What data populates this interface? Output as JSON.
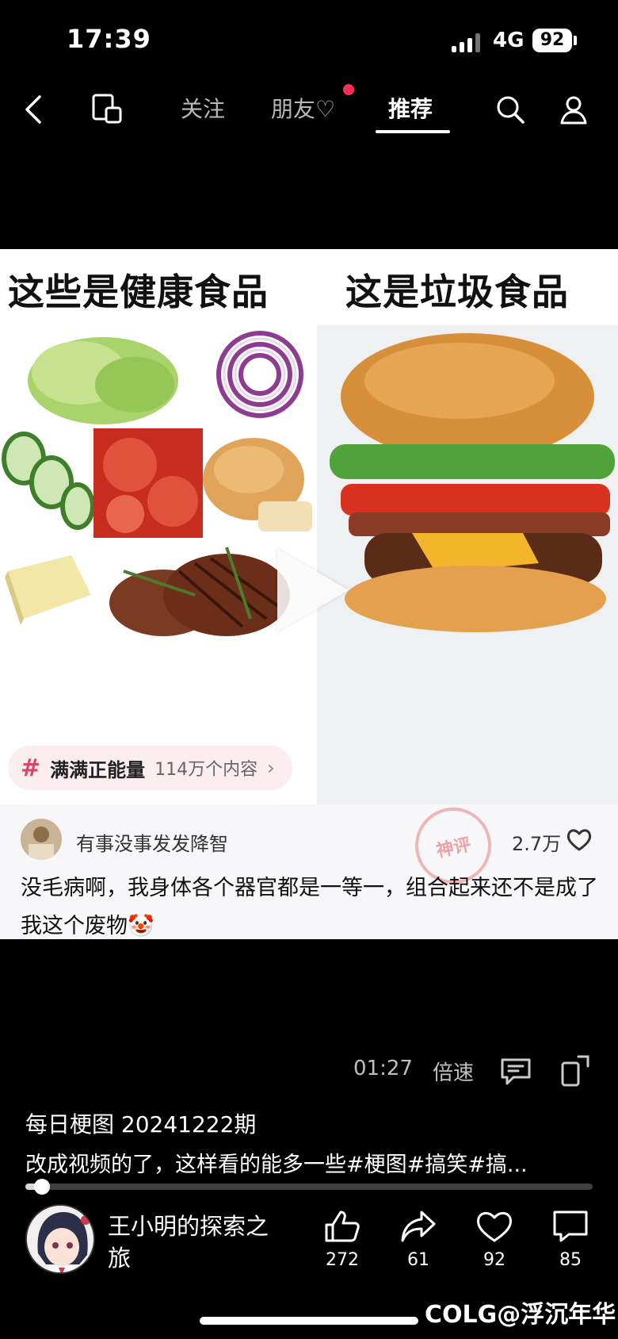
{
  "status_bar": {
    "time": "17:39",
    "network": "4G",
    "battery": "92"
  },
  "nav": {
    "tabs": [
      {
        "label": "关注",
        "active": false
      },
      {
        "label": "朋友♡",
        "active": false,
        "has_dot": true
      },
      {
        "label": "推荐",
        "active": true
      }
    ]
  },
  "meme": {
    "left_heading": "这些是健康食品",
    "right_heading": "这是垃圾食品",
    "topic": {
      "name": "满满正能量",
      "count": "114万个内容"
    },
    "comment": {
      "username": "有事没事发发降智",
      "likes": "2.7万",
      "text": "没毛病啊，我身体各个器官都是一等一，组合起来还不是成了我这个废物🤡",
      "stamp": "神评"
    }
  },
  "player": {
    "time": "01:27",
    "speed_label": "倍速",
    "progress_fraction": 0.03
  },
  "video": {
    "title": "每日梗图 20241222期",
    "description": "改成视频的了，这样看的能多一些#梗图#搞笑#搞..."
  },
  "author": {
    "name": "王小明的探索之旅"
  },
  "actions": [
    {
      "icon": "thumbs-up-icon",
      "count": "272"
    },
    {
      "icon": "share-icon",
      "count": "61"
    },
    {
      "icon": "heart-icon",
      "count": "92"
    },
    {
      "icon": "comment-icon",
      "count": "85"
    }
  ],
  "watermark": "COLG@浮沉年华",
  "colors": {
    "accent_red": "#ff2d55",
    "topic_hash": "#d9466a",
    "background": "#000000"
  }
}
